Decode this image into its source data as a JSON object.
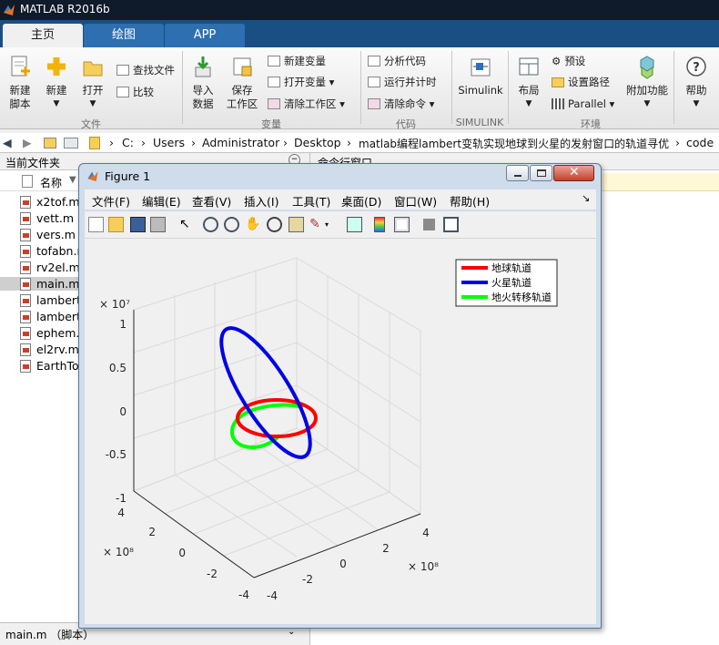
{
  "app": {
    "title": "MATLAB R2016b"
  },
  "ribbon_tabs": [
    "主页",
    "绘图",
    "APP"
  ],
  "ribbon": {
    "file": {
      "new_script": [
        "新建",
        "脚本"
      ],
      "new": "新建",
      "open": "打开",
      "find_files": "查找文件",
      "compare": "比较",
      "group": "文件"
    },
    "variable": {
      "import": [
        "导入",
        "数据"
      ],
      "save_ws": [
        "保存",
        "工作区"
      ],
      "new_var": "新建变量",
      "open_var": "打开变量",
      "clear_ws": "清除工作区",
      "group": "变量"
    },
    "code": {
      "analyze": "分析代码",
      "run_time": "运行并计时",
      "clear_cmds": "清除命令",
      "group": "代码"
    },
    "simulink": {
      "simulink": "Simulink",
      "group": "SIMULINK"
    },
    "env": {
      "layout": "布局",
      "prefs": "预设",
      "set_path": "设置路径",
      "parallel": "Parallel",
      "addons": "附加功能",
      "group": "环境"
    },
    "resources": {
      "help": "帮助"
    }
  },
  "address": {
    "parts": [
      "C:",
      "Users",
      "Administrator",
      "Desktop",
      "matlab编程lambert变轨实现地球到火星的发射窗口的轨道寻优",
      "code"
    ]
  },
  "left_panel": {
    "title": "当前文件夹",
    "column": "名称",
    "files": [
      "x2tof.m",
      "vett.m",
      "vers.m",
      "tofabn.m",
      "rv2el.m",
      "main.m",
      "lambert",
      "lambert",
      "ephem.m",
      "el2rv.m",
      "EarthTo"
    ],
    "status": "main.m （脚本）"
  },
  "command_window": {
    "title": "命令行窗口"
  },
  "figure": {
    "title": "Figure 1",
    "menus": [
      "文件(F)",
      "编辑(E)",
      "查看(V)",
      "插入(I)",
      "工具(T)",
      "桌面(D)",
      "窗口(W)",
      "帮助(H)"
    ],
    "legend": [
      "地球轨道",
      "火星轨道",
      "地火转移轨道"
    ],
    "colors": {
      "earth": "#ff0000",
      "mars": "#0000ff",
      "transfer": "#00ff00"
    },
    "z_exp": "× 10⁷",
    "x_exp": "× 10⁸",
    "y_exp": "× 10⁸",
    "z_ticks": [
      "1",
      "0.5",
      "0",
      "-0.5",
      "-1"
    ],
    "y_ticks": [
      "4",
      "2",
      "0",
      "-2",
      "-4"
    ],
    "x_ticks": [
      "-4",
      "-2",
      "0",
      "2",
      "4"
    ]
  }
}
